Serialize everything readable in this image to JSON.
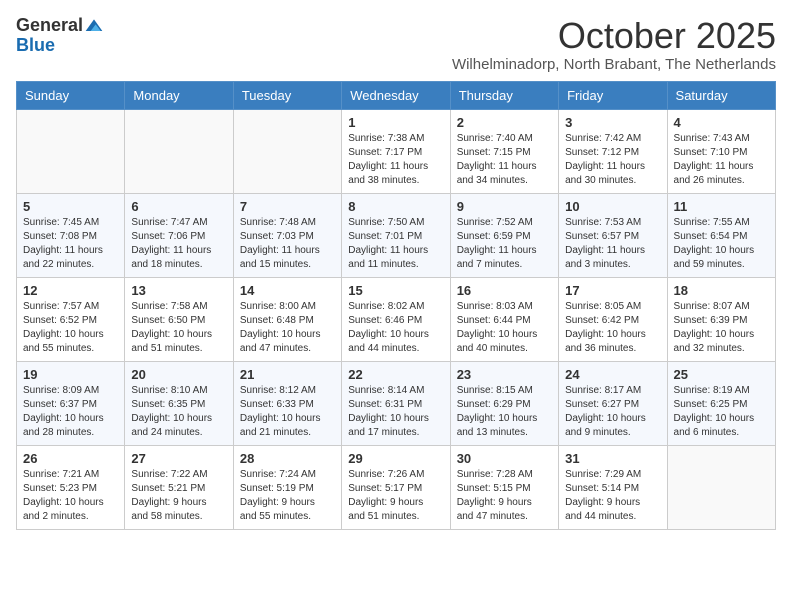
{
  "header": {
    "logo_general": "General",
    "logo_blue": "Blue",
    "month_title": "October 2025",
    "location": "Wilhelminadorp, North Brabant, The Netherlands"
  },
  "days_of_week": [
    "Sunday",
    "Monday",
    "Tuesday",
    "Wednesday",
    "Thursday",
    "Friday",
    "Saturday"
  ],
  "weeks": [
    [
      {
        "day": "",
        "info": ""
      },
      {
        "day": "",
        "info": ""
      },
      {
        "day": "",
        "info": ""
      },
      {
        "day": "1",
        "info": "Sunrise: 7:38 AM\nSunset: 7:17 PM\nDaylight: 11 hours\nand 38 minutes."
      },
      {
        "day": "2",
        "info": "Sunrise: 7:40 AM\nSunset: 7:15 PM\nDaylight: 11 hours\nand 34 minutes."
      },
      {
        "day": "3",
        "info": "Sunrise: 7:42 AM\nSunset: 7:12 PM\nDaylight: 11 hours\nand 30 minutes."
      },
      {
        "day": "4",
        "info": "Sunrise: 7:43 AM\nSunset: 7:10 PM\nDaylight: 11 hours\nand 26 minutes."
      }
    ],
    [
      {
        "day": "5",
        "info": "Sunrise: 7:45 AM\nSunset: 7:08 PM\nDaylight: 11 hours\nand 22 minutes."
      },
      {
        "day": "6",
        "info": "Sunrise: 7:47 AM\nSunset: 7:06 PM\nDaylight: 11 hours\nand 18 minutes."
      },
      {
        "day": "7",
        "info": "Sunrise: 7:48 AM\nSunset: 7:03 PM\nDaylight: 11 hours\nand 15 minutes."
      },
      {
        "day": "8",
        "info": "Sunrise: 7:50 AM\nSunset: 7:01 PM\nDaylight: 11 hours\nand 11 minutes."
      },
      {
        "day": "9",
        "info": "Sunrise: 7:52 AM\nSunset: 6:59 PM\nDaylight: 11 hours\nand 7 minutes."
      },
      {
        "day": "10",
        "info": "Sunrise: 7:53 AM\nSunset: 6:57 PM\nDaylight: 11 hours\nand 3 minutes."
      },
      {
        "day": "11",
        "info": "Sunrise: 7:55 AM\nSunset: 6:54 PM\nDaylight: 10 hours\nand 59 minutes."
      }
    ],
    [
      {
        "day": "12",
        "info": "Sunrise: 7:57 AM\nSunset: 6:52 PM\nDaylight: 10 hours\nand 55 minutes."
      },
      {
        "day": "13",
        "info": "Sunrise: 7:58 AM\nSunset: 6:50 PM\nDaylight: 10 hours\nand 51 minutes."
      },
      {
        "day": "14",
        "info": "Sunrise: 8:00 AM\nSunset: 6:48 PM\nDaylight: 10 hours\nand 47 minutes."
      },
      {
        "day": "15",
        "info": "Sunrise: 8:02 AM\nSunset: 6:46 PM\nDaylight: 10 hours\nand 44 minutes."
      },
      {
        "day": "16",
        "info": "Sunrise: 8:03 AM\nSunset: 6:44 PM\nDaylight: 10 hours\nand 40 minutes."
      },
      {
        "day": "17",
        "info": "Sunrise: 8:05 AM\nSunset: 6:42 PM\nDaylight: 10 hours\nand 36 minutes."
      },
      {
        "day": "18",
        "info": "Sunrise: 8:07 AM\nSunset: 6:39 PM\nDaylight: 10 hours\nand 32 minutes."
      }
    ],
    [
      {
        "day": "19",
        "info": "Sunrise: 8:09 AM\nSunset: 6:37 PM\nDaylight: 10 hours\nand 28 minutes."
      },
      {
        "day": "20",
        "info": "Sunrise: 8:10 AM\nSunset: 6:35 PM\nDaylight: 10 hours\nand 24 minutes."
      },
      {
        "day": "21",
        "info": "Sunrise: 8:12 AM\nSunset: 6:33 PM\nDaylight: 10 hours\nand 21 minutes."
      },
      {
        "day": "22",
        "info": "Sunrise: 8:14 AM\nSunset: 6:31 PM\nDaylight: 10 hours\nand 17 minutes."
      },
      {
        "day": "23",
        "info": "Sunrise: 8:15 AM\nSunset: 6:29 PM\nDaylight: 10 hours\nand 13 minutes."
      },
      {
        "day": "24",
        "info": "Sunrise: 8:17 AM\nSunset: 6:27 PM\nDaylight: 10 hours\nand 9 minutes."
      },
      {
        "day": "25",
        "info": "Sunrise: 8:19 AM\nSunset: 6:25 PM\nDaylight: 10 hours\nand 6 minutes."
      }
    ],
    [
      {
        "day": "26",
        "info": "Sunrise: 7:21 AM\nSunset: 5:23 PM\nDaylight: 10 hours\nand 2 minutes."
      },
      {
        "day": "27",
        "info": "Sunrise: 7:22 AM\nSunset: 5:21 PM\nDaylight: 9 hours\nand 58 minutes."
      },
      {
        "day": "28",
        "info": "Sunrise: 7:24 AM\nSunset: 5:19 PM\nDaylight: 9 hours\nand 55 minutes."
      },
      {
        "day": "29",
        "info": "Sunrise: 7:26 AM\nSunset: 5:17 PM\nDaylight: 9 hours\nand 51 minutes."
      },
      {
        "day": "30",
        "info": "Sunrise: 7:28 AM\nSunset: 5:15 PM\nDaylight: 9 hours\nand 47 minutes."
      },
      {
        "day": "31",
        "info": "Sunrise: 7:29 AM\nSunset: 5:14 PM\nDaylight: 9 hours\nand 44 minutes."
      },
      {
        "day": "",
        "info": ""
      }
    ]
  ]
}
